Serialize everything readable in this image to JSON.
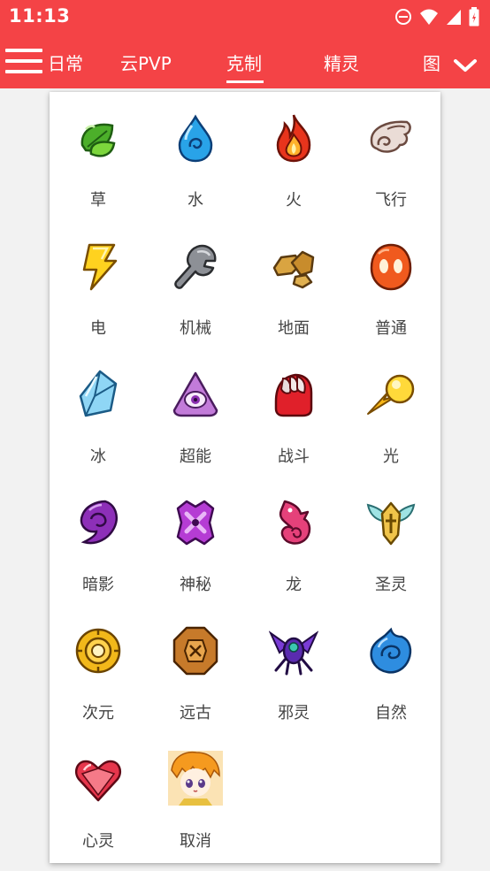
{
  "status_bar": {
    "time": "11:13"
  },
  "app_bar": {
    "tabs": [
      {
        "label": "日常"
      },
      {
        "label": "云PVP"
      },
      {
        "label": "克制"
      },
      {
        "label": "精灵"
      },
      {
        "label": "图"
      }
    ],
    "active_tab": "克制"
  },
  "type_grid": {
    "items": [
      {
        "label": "草",
        "icon": "grass-leaf-icon"
      },
      {
        "label": "水",
        "icon": "water-drop-icon"
      },
      {
        "label": "火",
        "icon": "fire-flame-icon"
      },
      {
        "label": "飞行",
        "icon": "flying-wing-icon"
      },
      {
        "label": "电",
        "icon": "electric-bolt-icon"
      },
      {
        "label": "机械",
        "icon": "mechanical-wrench-icon"
      },
      {
        "label": "地面",
        "icon": "ground-rock-icon"
      },
      {
        "label": "普通",
        "icon": "normal-orb-icon"
      },
      {
        "label": "冰",
        "icon": "ice-crystal-icon"
      },
      {
        "label": "超能",
        "icon": "psychic-eye-icon"
      },
      {
        "label": "战斗",
        "icon": "fighting-fist-icon"
      },
      {
        "label": "光",
        "icon": "light-comet-icon"
      },
      {
        "label": "暗影",
        "icon": "shadow-swirl-icon"
      },
      {
        "label": "神秘",
        "icon": "mystery-rune-icon"
      },
      {
        "label": "龙",
        "icon": "dragon-icon"
      },
      {
        "label": "圣灵",
        "icon": "holy-emblem-icon"
      },
      {
        "label": "次元",
        "icon": "dimension-ring-icon"
      },
      {
        "label": "远古",
        "icon": "ancient-tablet-icon"
      },
      {
        "label": "邪灵",
        "icon": "evil-insect-icon"
      },
      {
        "label": "自然",
        "icon": "nature-swirl-icon"
      },
      {
        "label": "心灵",
        "icon": "heart-gem-icon"
      },
      {
        "label": "取消",
        "icon": "cancel-character-avatar"
      }
    ]
  },
  "colors": {
    "accent": "#f44346",
    "panel": "#ffffff",
    "background": "#f2f2f2",
    "label_text": "#444444"
  }
}
